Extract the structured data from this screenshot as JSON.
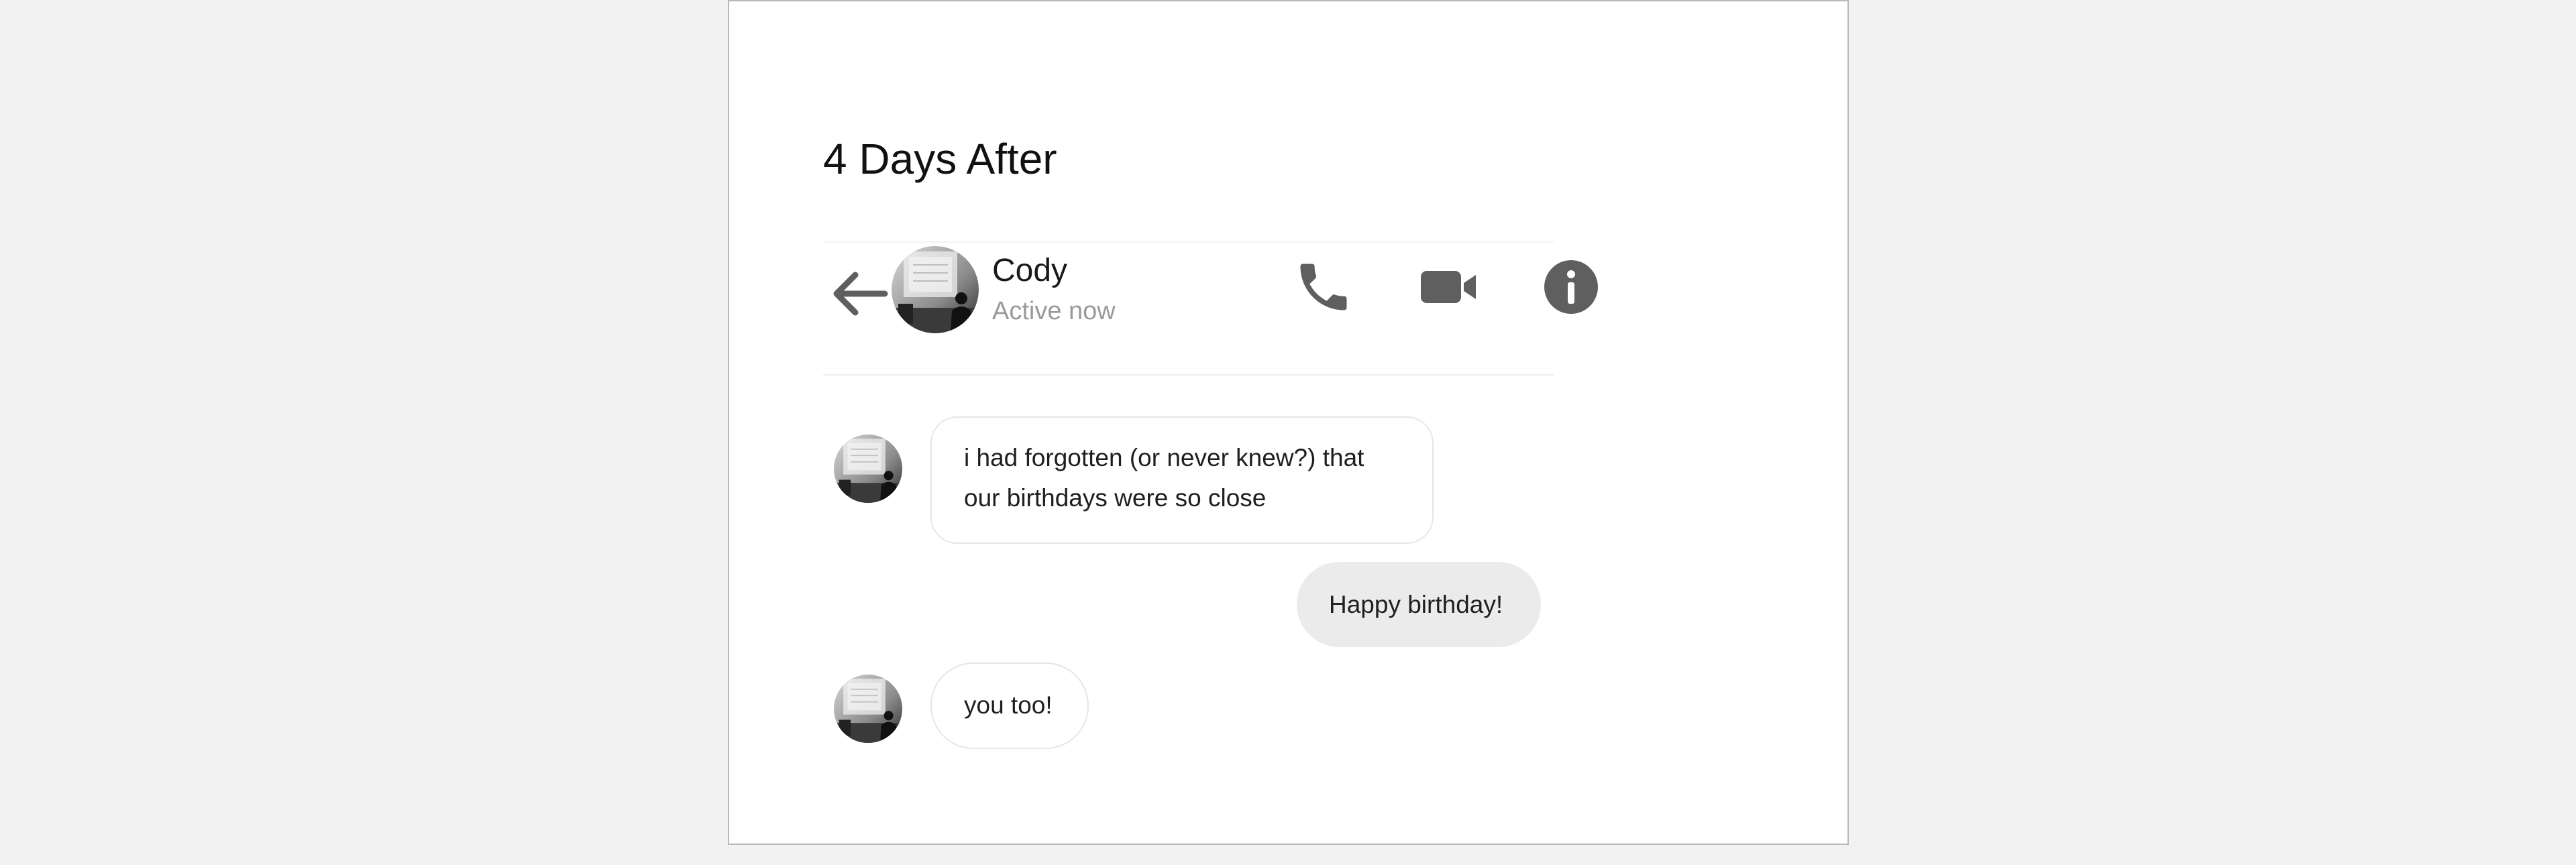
{
  "heading": "4 Days After",
  "header": {
    "contact_name": "Cody",
    "status": "Active now",
    "icons": [
      "back-arrow-icon",
      "phone-icon",
      "video-camera-icon",
      "info-icon"
    ]
  },
  "messages": [
    {
      "direction": "incoming",
      "text": "i had forgotten (or never knew?) that our birthdays were so close"
    },
    {
      "direction": "outgoing",
      "text": "Happy birthday!"
    },
    {
      "direction": "incoming",
      "text": "you too!"
    }
  ],
  "colors": {
    "icon": "#5f5f5f",
    "incoming_bubble": "#ffffff",
    "outgoing_bubble": "#ebebeb",
    "status_text": "#9a9a9a"
  }
}
